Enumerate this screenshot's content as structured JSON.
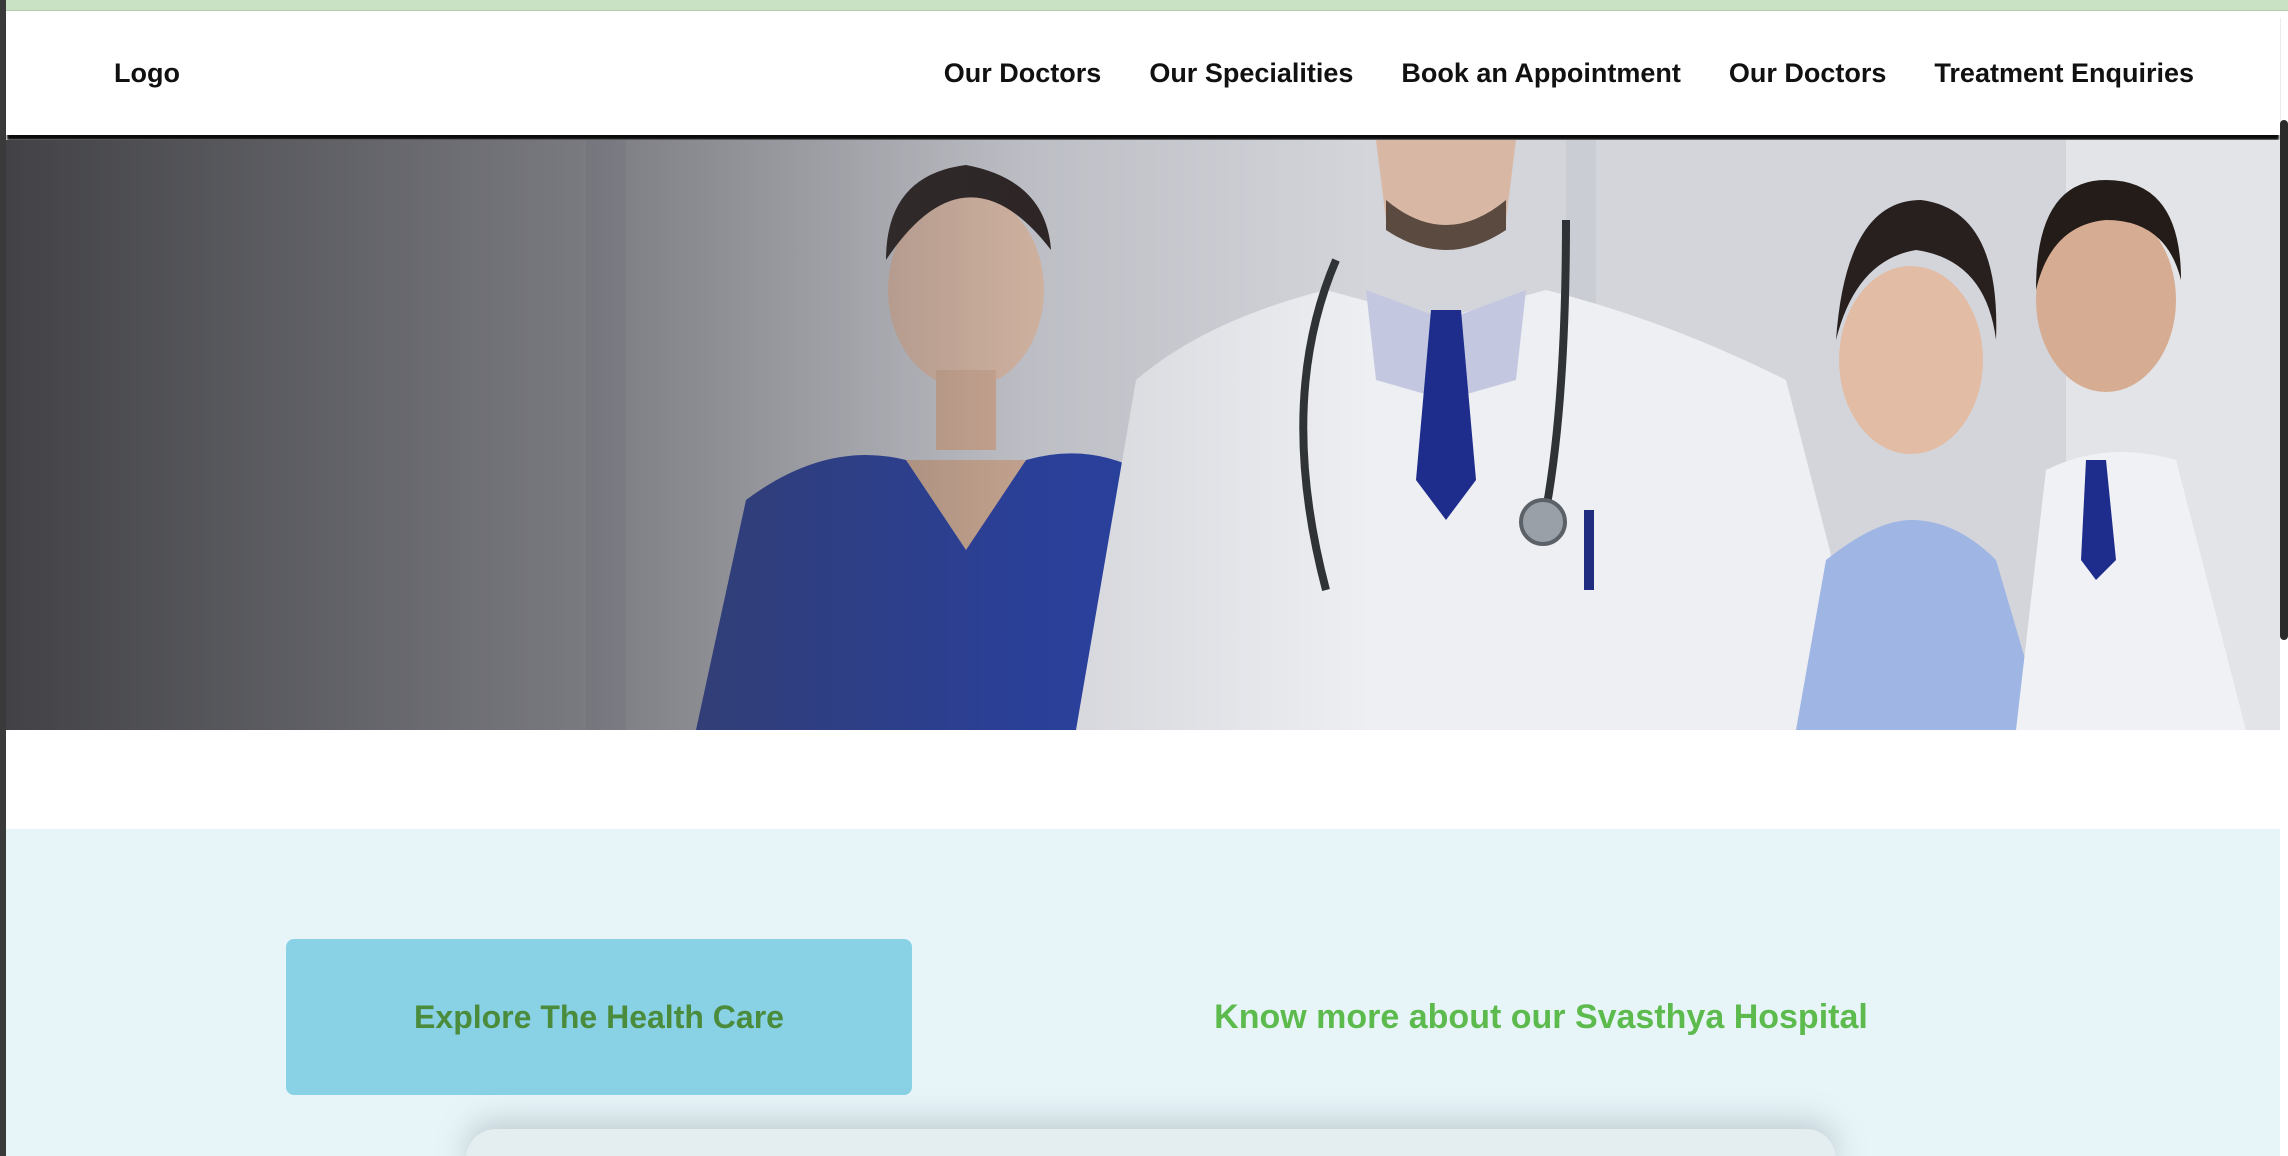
{
  "header": {
    "logo_text": "Logo",
    "nav": [
      {
        "label": "Our Doctors"
      },
      {
        "label": "Our Specialities"
      },
      {
        "label": "Book an Appointment"
      },
      {
        "label": "Our Doctors"
      },
      {
        "label": "Treatment Enquiries"
      }
    ]
  },
  "hero": {
    "image": "medical-team-photo"
  },
  "info": {
    "explore_button_label": "Explore The Health Care",
    "heading": "Know more about our Svasthya Hospital"
  },
  "colors": {
    "top_strip": "#c9e2c4",
    "info_background": "#e7f5f9",
    "explore_button_bg": "#89d1e5",
    "explore_button_text": "#4b8c3c",
    "heading_text": "#5dbb4e"
  }
}
